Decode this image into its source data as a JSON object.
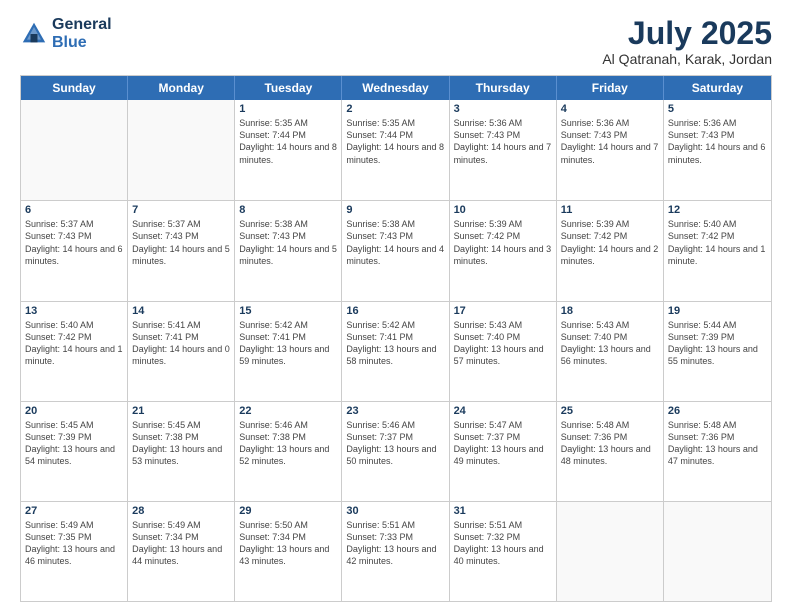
{
  "header": {
    "logo_line1": "General",
    "logo_line2": "Blue",
    "month": "July 2025",
    "location": "Al Qatranah, Karak, Jordan"
  },
  "weekdays": [
    "Sunday",
    "Monday",
    "Tuesday",
    "Wednesday",
    "Thursday",
    "Friday",
    "Saturday"
  ],
  "weeks": [
    [
      {
        "day": "",
        "sunrise": "",
        "sunset": "",
        "daylight": "",
        "empty": true
      },
      {
        "day": "",
        "sunrise": "",
        "sunset": "",
        "daylight": "",
        "empty": true
      },
      {
        "day": "1",
        "sunrise": "Sunrise: 5:35 AM",
        "sunset": "Sunset: 7:44 PM",
        "daylight": "Daylight: 14 hours and 8 minutes."
      },
      {
        "day": "2",
        "sunrise": "Sunrise: 5:35 AM",
        "sunset": "Sunset: 7:44 PM",
        "daylight": "Daylight: 14 hours and 8 minutes."
      },
      {
        "day": "3",
        "sunrise": "Sunrise: 5:36 AM",
        "sunset": "Sunset: 7:43 PM",
        "daylight": "Daylight: 14 hours and 7 minutes."
      },
      {
        "day": "4",
        "sunrise": "Sunrise: 5:36 AM",
        "sunset": "Sunset: 7:43 PM",
        "daylight": "Daylight: 14 hours and 7 minutes."
      },
      {
        "day": "5",
        "sunrise": "Sunrise: 5:36 AM",
        "sunset": "Sunset: 7:43 PM",
        "daylight": "Daylight: 14 hours and 6 minutes."
      }
    ],
    [
      {
        "day": "6",
        "sunrise": "Sunrise: 5:37 AM",
        "sunset": "Sunset: 7:43 PM",
        "daylight": "Daylight: 14 hours and 6 minutes."
      },
      {
        "day": "7",
        "sunrise": "Sunrise: 5:37 AM",
        "sunset": "Sunset: 7:43 PM",
        "daylight": "Daylight: 14 hours and 5 minutes."
      },
      {
        "day": "8",
        "sunrise": "Sunrise: 5:38 AM",
        "sunset": "Sunset: 7:43 PM",
        "daylight": "Daylight: 14 hours and 5 minutes."
      },
      {
        "day": "9",
        "sunrise": "Sunrise: 5:38 AM",
        "sunset": "Sunset: 7:43 PM",
        "daylight": "Daylight: 14 hours and 4 minutes."
      },
      {
        "day": "10",
        "sunrise": "Sunrise: 5:39 AM",
        "sunset": "Sunset: 7:42 PM",
        "daylight": "Daylight: 14 hours and 3 minutes."
      },
      {
        "day": "11",
        "sunrise": "Sunrise: 5:39 AM",
        "sunset": "Sunset: 7:42 PM",
        "daylight": "Daylight: 14 hours and 2 minutes."
      },
      {
        "day": "12",
        "sunrise": "Sunrise: 5:40 AM",
        "sunset": "Sunset: 7:42 PM",
        "daylight": "Daylight: 14 hours and 1 minute."
      }
    ],
    [
      {
        "day": "13",
        "sunrise": "Sunrise: 5:40 AM",
        "sunset": "Sunset: 7:42 PM",
        "daylight": "Daylight: 14 hours and 1 minute."
      },
      {
        "day": "14",
        "sunrise": "Sunrise: 5:41 AM",
        "sunset": "Sunset: 7:41 PM",
        "daylight": "Daylight: 14 hours and 0 minutes."
      },
      {
        "day": "15",
        "sunrise": "Sunrise: 5:42 AM",
        "sunset": "Sunset: 7:41 PM",
        "daylight": "Daylight: 13 hours and 59 minutes."
      },
      {
        "day": "16",
        "sunrise": "Sunrise: 5:42 AM",
        "sunset": "Sunset: 7:41 PM",
        "daylight": "Daylight: 13 hours and 58 minutes."
      },
      {
        "day": "17",
        "sunrise": "Sunrise: 5:43 AM",
        "sunset": "Sunset: 7:40 PM",
        "daylight": "Daylight: 13 hours and 57 minutes."
      },
      {
        "day": "18",
        "sunrise": "Sunrise: 5:43 AM",
        "sunset": "Sunset: 7:40 PM",
        "daylight": "Daylight: 13 hours and 56 minutes."
      },
      {
        "day": "19",
        "sunrise": "Sunrise: 5:44 AM",
        "sunset": "Sunset: 7:39 PM",
        "daylight": "Daylight: 13 hours and 55 minutes."
      }
    ],
    [
      {
        "day": "20",
        "sunrise": "Sunrise: 5:45 AM",
        "sunset": "Sunset: 7:39 PM",
        "daylight": "Daylight: 13 hours and 54 minutes."
      },
      {
        "day": "21",
        "sunrise": "Sunrise: 5:45 AM",
        "sunset": "Sunset: 7:38 PM",
        "daylight": "Daylight: 13 hours and 53 minutes."
      },
      {
        "day": "22",
        "sunrise": "Sunrise: 5:46 AM",
        "sunset": "Sunset: 7:38 PM",
        "daylight": "Daylight: 13 hours and 52 minutes."
      },
      {
        "day": "23",
        "sunrise": "Sunrise: 5:46 AM",
        "sunset": "Sunset: 7:37 PM",
        "daylight": "Daylight: 13 hours and 50 minutes."
      },
      {
        "day": "24",
        "sunrise": "Sunrise: 5:47 AM",
        "sunset": "Sunset: 7:37 PM",
        "daylight": "Daylight: 13 hours and 49 minutes."
      },
      {
        "day": "25",
        "sunrise": "Sunrise: 5:48 AM",
        "sunset": "Sunset: 7:36 PM",
        "daylight": "Daylight: 13 hours and 48 minutes."
      },
      {
        "day": "26",
        "sunrise": "Sunrise: 5:48 AM",
        "sunset": "Sunset: 7:36 PM",
        "daylight": "Daylight: 13 hours and 47 minutes."
      }
    ],
    [
      {
        "day": "27",
        "sunrise": "Sunrise: 5:49 AM",
        "sunset": "Sunset: 7:35 PM",
        "daylight": "Daylight: 13 hours and 46 minutes."
      },
      {
        "day": "28",
        "sunrise": "Sunrise: 5:49 AM",
        "sunset": "Sunset: 7:34 PM",
        "daylight": "Daylight: 13 hours and 44 minutes."
      },
      {
        "day": "29",
        "sunrise": "Sunrise: 5:50 AM",
        "sunset": "Sunset: 7:34 PM",
        "daylight": "Daylight: 13 hours and 43 minutes."
      },
      {
        "day": "30",
        "sunrise": "Sunrise: 5:51 AM",
        "sunset": "Sunset: 7:33 PM",
        "daylight": "Daylight: 13 hours and 42 minutes."
      },
      {
        "day": "31",
        "sunrise": "Sunrise: 5:51 AM",
        "sunset": "Sunset: 7:32 PM",
        "daylight": "Daylight: 13 hours and 40 minutes."
      },
      {
        "day": "",
        "sunrise": "",
        "sunset": "",
        "daylight": "",
        "empty": true
      },
      {
        "day": "",
        "sunrise": "",
        "sunset": "",
        "daylight": "",
        "empty": true
      }
    ]
  ]
}
